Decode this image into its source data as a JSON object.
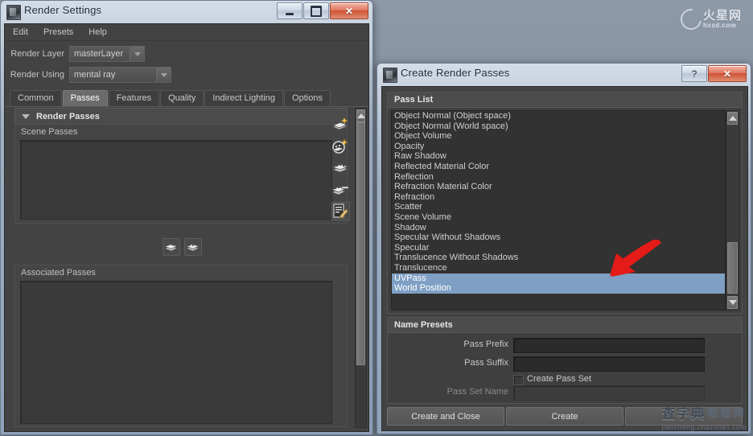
{
  "desktop": {
    "background_color": "#808d9d",
    "watermark_top": {
      "brand": "火星网",
      "domain": "hxsd.com",
      "icon": "swoosh-icon"
    },
    "watermark_bottom": {
      "brand1": "查字典",
      "brand2": "教程网",
      "url": "jiaocheng.chazidian.com"
    }
  },
  "render_settings": {
    "title": "Render Settings",
    "window_icon": "maya-app-icon",
    "caption": {
      "minimize": "—",
      "maximize": "❐",
      "close": "✕"
    },
    "menu": [
      "Edit",
      "Presets",
      "Help"
    ],
    "fields": [
      {
        "label": "Render Layer",
        "value": "masterLayer"
      },
      {
        "label": "Render Using",
        "value": "mental ray"
      }
    ],
    "tabs": [
      {
        "label": "Common",
        "active": false
      },
      {
        "label": "Passes",
        "active": true
      },
      {
        "label": "Features",
        "active": false
      },
      {
        "label": "Quality",
        "active": false
      },
      {
        "label": "Indirect Lighting",
        "active": false
      },
      {
        "label": "Options",
        "active": false
      }
    ],
    "section": {
      "title": "Render Passes",
      "collapse_icon": "chevron-down-icon"
    },
    "scene_passes_label": "Scene Passes",
    "associated_passes_label": "Associated Passes",
    "side_icons": [
      "create-new-pass-icon",
      "create-new-pass-contribution-map-icon",
      "duplicate-pass-icon",
      "remove-pass-icon",
      "edit-pass-attributes-icon"
    ],
    "middle_icons": [
      "associate-pass-icon",
      "disassociate-pass-icon"
    ]
  },
  "create_render_passes": {
    "title": "Create Render Passes",
    "window_icon": "maya-app-icon",
    "caption": {
      "help": "?",
      "close": "✕"
    },
    "pass_list": {
      "group_title": "Pass List",
      "items": [
        {
          "label": "Object Normal (Object space)",
          "selected": false
        },
        {
          "label": "Object Normal (World space)",
          "selected": false
        },
        {
          "label": "Object Volume",
          "selected": false
        },
        {
          "label": "Opacity",
          "selected": false
        },
        {
          "label": "Raw Shadow",
          "selected": false
        },
        {
          "label": "Reflected Material Color",
          "selected": false
        },
        {
          "label": "Reflection",
          "selected": false
        },
        {
          "label": "Refraction Material Color",
          "selected": false
        },
        {
          "label": "Refraction",
          "selected": false
        },
        {
          "label": "Scatter",
          "selected": false
        },
        {
          "label": "Scene Volume",
          "selected": false
        },
        {
          "label": "Shadow",
          "selected": false
        },
        {
          "label": "Specular Without Shadows",
          "selected": false
        },
        {
          "label": "Specular",
          "selected": false
        },
        {
          "label": "Translucence Without Shadows",
          "selected": false
        },
        {
          "label": "Translucence",
          "selected": false
        },
        {
          "label": "UVPass",
          "selected": true
        },
        {
          "label": "World Position",
          "selected": true
        }
      ]
    },
    "name_presets": {
      "group_title": "Name Presets",
      "pass_prefix": {
        "label": "Pass Prefix",
        "value": "",
        "placeholder": ""
      },
      "pass_suffix": {
        "label": "Pass Suffix",
        "value": "",
        "placeholder": ""
      },
      "create_pass_set": {
        "label": "Create Pass Set",
        "checked": false
      },
      "pass_set_name": {
        "label": "Pass Set Name",
        "value": "",
        "placeholder": "",
        "disabled": true
      }
    },
    "buttons": [
      {
        "label": "Create and Close"
      },
      {
        "label": "Create"
      },
      {
        "label": ""
      }
    ]
  },
  "annotation": {
    "type": "red-arrow",
    "color": "#e41b17",
    "points_to": "UVPass / World Position selection"
  }
}
